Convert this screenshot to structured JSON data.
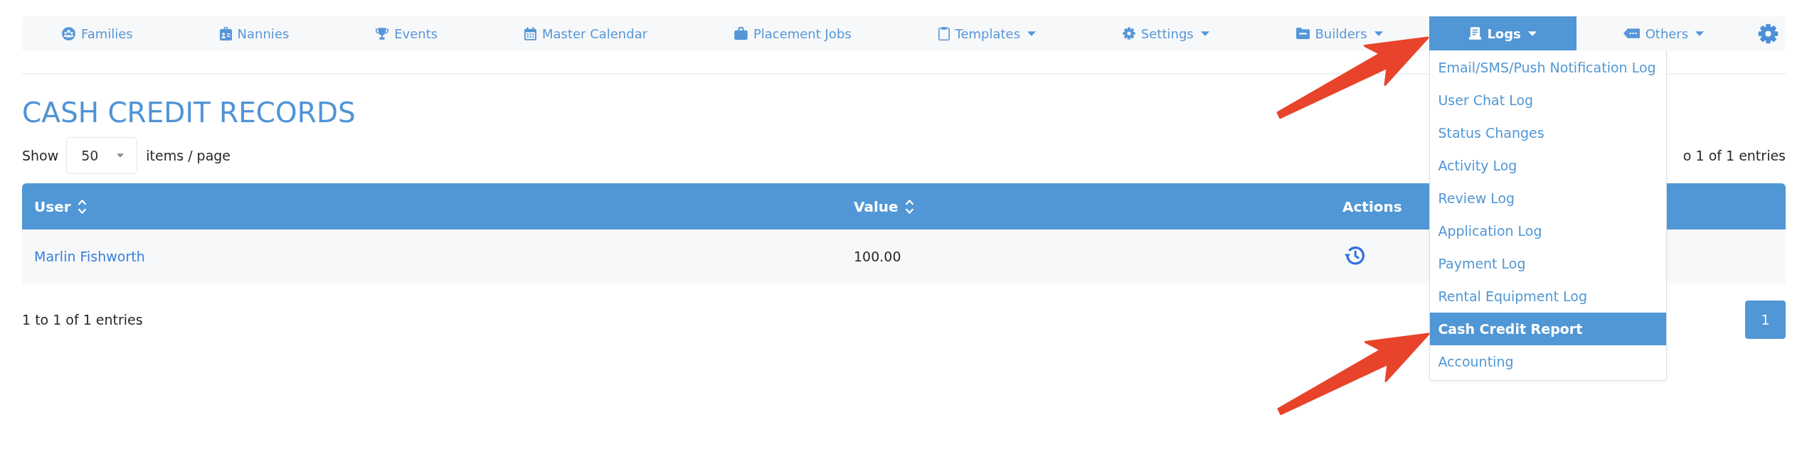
{
  "nav": {
    "items": [
      {
        "label": "Families",
        "dropdown": false,
        "selected": false,
        "arrow": false
      },
      {
        "label": "Nannies",
        "dropdown": false,
        "selected": false,
        "arrow": false
      },
      {
        "label": "Events",
        "dropdown": false,
        "selected": false,
        "arrow": false
      },
      {
        "label": "Master Calendar",
        "dropdown": false,
        "selected": false,
        "arrow": false
      },
      {
        "label": "Placement Jobs",
        "dropdown": false,
        "selected": false,
        "arrow": false
      },
      {
        "label": "Templates",
        "dropdown": true,
        "selected": false,
        "expanded": false,
        "arrow": false
      },
      {
        "label": "Settings",
        "dropdown": true,
        "selected": false,
        "expanded": false,
        "arrow": false
      },
      {
        "label": "Builders",
        "dropdown": true,
        "selected": false,
        "expanded": false,
        "arrow": false
      },
      {
        "label": "Logs",
        "dropdown": true,
        "selected": true,
        "expanded": true,
        "arrow": true,
        "menu_items": [
          {
            "label": "Email/SMS/Push Notification Log",
            "selected": false,
            "arrow": false
          },
          {
            "label": "User Chat Log",
            "selected": false,
            "arrow": false
          },
          {
            "label": "Status Changes",
            "selected": false,
            "arrow": false
          },
          {
            "label": "Activity Log",
            "selected": false,
            "arrow": false
          },
          {
            "label": "Review Log",
            "selected": false,
            "arrow": false
          },
          {
            "label": "Application Log",
            "selected": false,
            "arrow": false
          },
          {
            "label": "Payment Log",
            "selected": false,
            "arrow": false
          },
          {
            "label": "Rental Equipment Log",
            "selected": false,
            "arrow": false
          },
          {
            "label": "Cash Credit Report",
            "selected": true,
            "arrow": true
          },
          {
            "label": "Accounting",
            "selected": false,
            "arrow": false
          }
        ]
      },
      {
        "label": "Others",
        "dropdown": true,
        "selected": false,
        "expanded": false,
        "arrow": false
      }
    ]
  },
  "page": {
    "title": "CASH CREDIT RECORDS",
    "show_label": "Show",
    "page_size": "50",
    "page_size_suffix": "items / page",
    "entries_info": "o 1 of 1 entries"
  },
  "table": {
    "columns": [
      {
        "label": "User",
        "sortable": true,
        "kind": "link"
      },
      {
        "label": "Value",
        "sortable": true,
        "kind": "text"
      },
      {
        "label": "Actions",
        "sortable": false,
        "kind": "actions"
      }
    ],
    "rows": [
      {
        "cells": [
          "Marlin Fishworth",
          "100.00"
        ]
      }
    ]
  },
  "footer": {
    "entries_info": "1 to 1 of 1 entries",
    "pages": [
      {
        "label": "1",
        "selected": true
      }
    ]
  }
}
